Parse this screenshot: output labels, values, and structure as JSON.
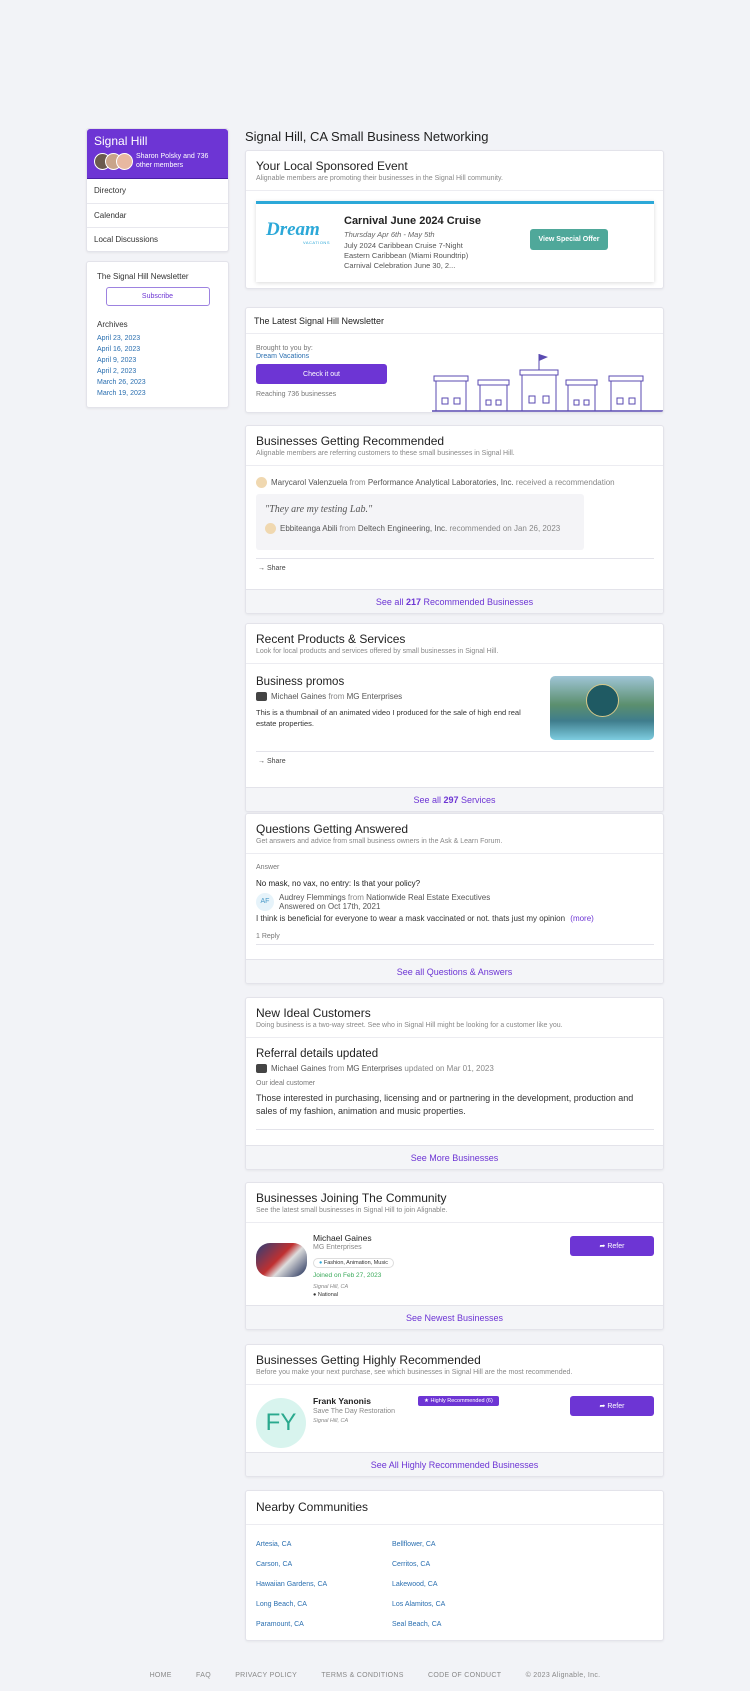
{
  "community": {
    "name": "Signal Hill",
    "members_text": "Sharon Polsky and 736 other members"
  },
  "sidebar": {
    "nav": [
      "Directory",
      "Calendar",
      "Local Discussions"
    ],
    "newsletter_title": "The Signal Hill Newsletter",
    "subscribe": "Subscribe",
    "archives_label": "Archives",
    "archives": [
      "April 23, 2023",
      "April 16, 2023",
      "April 9, 2023",
      "April 2, 2023",
      "March 26, 2023",
      "March 19, 2023"
    ]
  },
  "page_title": "Signal Hill, CA Small Business Networking",
  "sponsored": {
    "title": "Your Local Sponsored Event",
    "subtitle": "Alignable members are promoting their businesses in the Signal Hill community.",
    "logo_text": "Dream",
    "logo_sub": "VACATIONS",
    "event_title": "Carnival June 2024 Cruise",
    "event_date": "Thursday Apr 6th - May 5th",
    "desc1": "July 2024 Caribbean Cruise 7-Night",
    "desc2": "Eastern Caribbean (Miami Roundtrip)",
    "desc3": "Carnival Celebration June 30, 2...",
    "offer_btn": "View Special Offer"
  },
  "newsletter": {
    "title": "The Latest Signal Hill Newsletter",
    "brought": "Brought to you by:",
    "sponsor": "Dream Vacations",
    "button": "Check it out",
    "reach": "Reaching 736 businesses"
  },
  "recommended": {
    "title": "Businesses Getting Recommended",
    "subtitle": "Alignable members are referring customers to these small businesses in Signal Hill.",
    "person": "Marycarol Valenzuela",
    "from": "from",
    "company": "Performance Analytical Laboratories, Inc.",
    "received": "received a recommendation",
    "quote": "\"They are my testing Lab.\"",
    "recommender": "Ebbiteanga Abili",
    "rec_company": "Deltech Engineering, Inc.",
    "rec_date": "recommended on Jan 26, 2023",
    "share": "Share",
    "see_all_pre": "See all",
    "see_all_count": "217",
    "see_all_post": "Recommended Businesses"
  },
  "products": {
    "title": "Recent Products & Services",
    "subtitle": "Look for local products and services offered by small businesses in Signal Hill.",
    "item_title": "Business promos",
    "owner": "Michael Gaines",
    "from": "from",
    "company": "MG Enterprises",
    "desc": "This is a thumbnail of an animated video I produced for the sale of high end real estate properties.",
    "share": "Share",
    "see_all_pre": "See all",
    "see_all_count": "297",
    "see_all_post": "Services"
  },
  "questions": {
    "title": "Questions Getting Answered",
    "subtitle": "Get answers and advice from small business owners in the Ask & Learn Forum.",
    "label": "Answer",
    "question": "No mask, no vax, no entry: Is that your policy?",
    "initials": "AF",
    "answerer": "Audrey Flemmings",
    "from": "from",
    "company": "Nationwide Real Estate Executives",
    "answered": "Answered on Oct 17th, 2021",
    "answer": "I think is beneficial for everyone to wear a mask vaccinated or not. thats just my opinion",
    "more": "(more)",
    "replies": "1 Reply",
    "see_all": "See all Questions & Answers"
  },
  "ideal": {
    "title": "New Ideal Customers",
    "subtitle": "Doing business is a two-way street. See who in Signal Hill might be looking for a customer like you.",
    "item_title": "Referral details updated",
    "owner": "Michael Gaines",
    "from": "from",
    "company": "MG Enterprises",
    "updated": "updated on Mar 01, 2023",
    "label": "Our ideal customer",
    "desc": "Those interested in purchasing, licensing and or partnering in the development, production and sales of my fashion, animation and music properties.",
    "see_more": "See More Businesses"
  },
  "joining": {
    "title": "Businesses Joining The Community",
    "subtitle": "See the latest small businesses in Signal Hill to join Alignable.",
    "name": "Michael Gaines",
    "company": "MG Enterprises",
    "tags": "Fashion, Animation, Music",
    "joined": "Joined on Feb 27, 2023",
    "location": "Signal Hill, CA",
    "scope": "National",
    "refer": "Refer",
    "see_newest": "See Newest Businesses"
  },
  "highly": {
    "title": "Businesses Getting Highly Recommended",
    "subtitle": "Before you make your next purchase, see which businesses in Signal Hill are the most recommended.",
    "initials": "FY",
    "name": "Frank Yanonis",
    "badge": "Highly Recommended (6)",
    "company": "Save The Day Restoration",
    "location": "Signal Hill, CA",
    "refer": "Refer",
    "see_all": "See All Highly Recommended Businesses"
  },
  "nearby": {
    "title": "Nearby Communities",
    "col1": [
      "Artesia, CA",
      "Carson, CA",
      "Hawaiian Gardens, CA",
      "Long Beach, CA",
      "Paramount, CA"
    ],
    "col2": [
      "Bellflower, CA",
      "Cerritos, CA",
      "Lakewood, CA",
      "Los Alamitos, CA",
      "Seal Beach, CA"
    ]
  },
  "footer": {
    "links": [
      "HOME",
      "FAQ",
      "PRIVACY POLICY",
      "TERMS & CONDITIONS",
      "CODE OF CONDUCT"
    ],
    "copyright": "© 2023 Alignable, Inc."
  },
  "colors": {
    "purple": "#6d35d4",
    "teal": "#4fa89a",
    "link": "#2a6fb0",
    "green": "#3aaa5a"
  }
}
